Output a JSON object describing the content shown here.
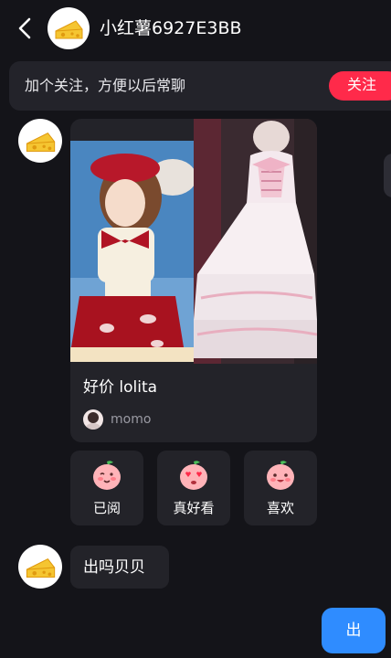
{
  "header": {
    "title": "小红薯6927E3BB",
    "back_icon": "chevron-left-icon",
    "avatar_icon": "cheese-avatar-icon"
  },
  "follow_banner": {
    "text": "加个关注，方便以后常聊",
    "button_label": "关注"
  },
  "post_card": {
    "title": "好价 lolita",
    "author": "momo",
    "images": [
      "red-lolita-dress-photo",
      "white-lolita-dress-photo"
    ]
  },
  "reactions": [
    {
      "label": "已阅",
      "icon": "peach-wink-icon"
    },
    {
      "label": "真好看",
      "icon": "peach-heart-eyes-icon"
    },
    {
      "label": "喜欢",
      "icon": "peach-smile-icon"
    }
  ],
  "messages": [
    {
      "text": "出吗贝贝"
    }
  ],
  "send_button": {
    "label": "出"
  },
  "colors": {
    "background": "#141419",
    "bubble": "#232329",
    "follow_accent": "#ff2a4a",
    "send_accent": "#2f8cff"
  }
}
